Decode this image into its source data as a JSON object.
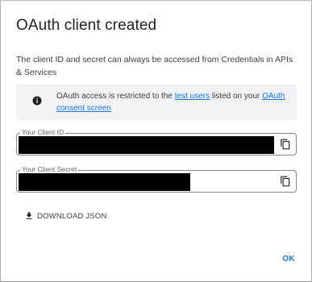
{
  "dialog": {
    "title": "OAuth client created",
    "description": "The client ID and secret can always be accessed from Credentials in APIs & Services",
    "notice": {
      "prefix": "OAuth access is restricted to the ",
      "link1": "test users",
      "middle": " listed on your ",
      "link2": "OAuth consent screen"
    },
    "client_id": {
      "label": "Your Client ID"
    },
    "client_secret": {
      "label": "Your Client Secret"
    },
    "download_label": "DOWNLOAD JSON",
    "ok_label": "OK"
  },
  "colors": {
    "accent": "#1a73e8",
    "notice_bg": "#f1f3f4",
    "redaction": "#000000"
  },
  "icons": [
    "info-icon",
    "copy-icon",
    "download-icon"
  ]
}
